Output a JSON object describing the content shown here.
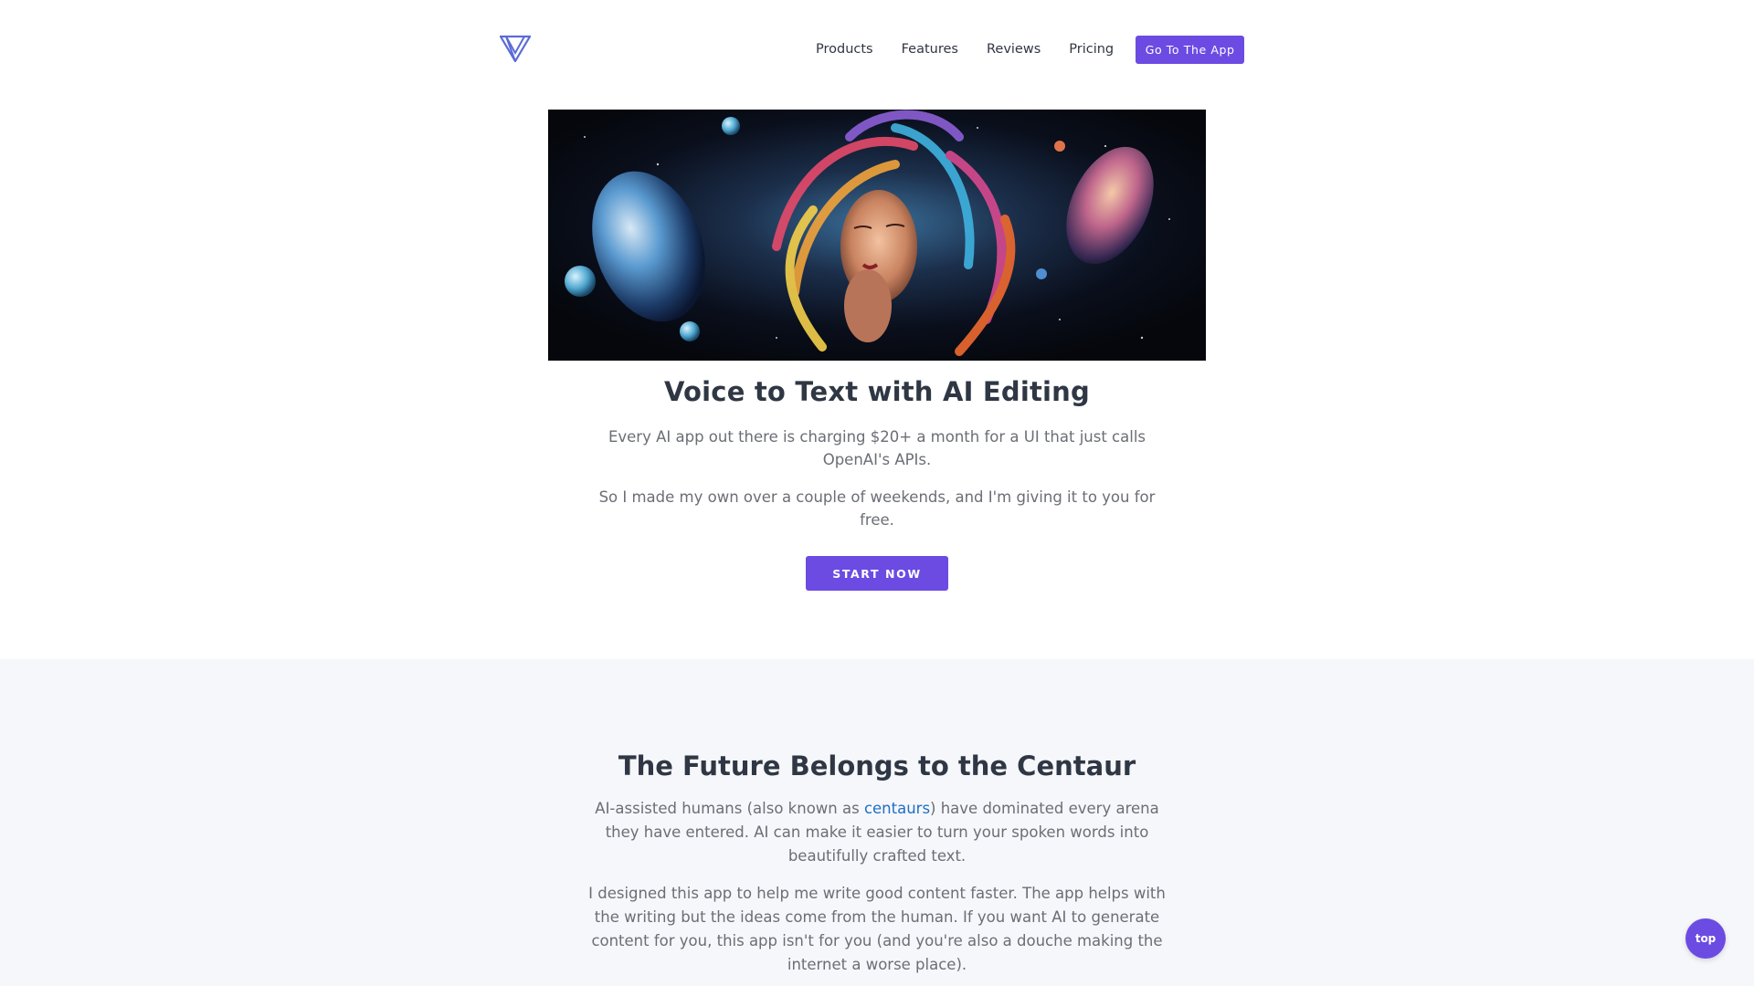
{
  "colors": {
    "accent": "#6c4be3",
    "heading": "#2f3744",
    "body_text": "#6b6e75",
    "link": "#1f6fc5",
    "section_bg": "#f6f7fb",
    "logo": "#5a6bd8"
  },
  "header": {
    "logo_icon": "v-logo-icon",
    "nav": [
      {
        "label": "Products"
      },
      {
        "label": "Features"
      },
      {
        "label": "Reviews"
      },
      {
        "label": "Pricing"
      }
    ],
    "cta_label": "Go To The App"
  },
  "hero": {
    "title": "Voice to Text with AI Editing",
    "paragraph1": "Every AI app out there is charging $20+ a month for a UI that just calls OpenAI's APIs.",
    "paragraph2": "So I made my own over a couple of weekends, and I'm giving it to you for free.",
    "button_label": "START NOW"
  },
  "section2": {
    "title": "The Future Belongs to the Centaur",
    "paragraph1_before": "AI-assisted humans (also known as ",
    "paragraph1_link": "centaurs",
    "paragraph1_after": ") have dominated every arena they have entered. AI can make it easier to turn your spoken words into beautifully crafted text.",
    "paragraph2": "I designed this app to help me write good content faster. The app helps with the writing but the ideas come from the human. If you want AI to generate content for you, this app isn't for you (and you're also a douche making the internet a worse place)."
  },
  "back_to_top": {
    "label": "top"
  }
}
